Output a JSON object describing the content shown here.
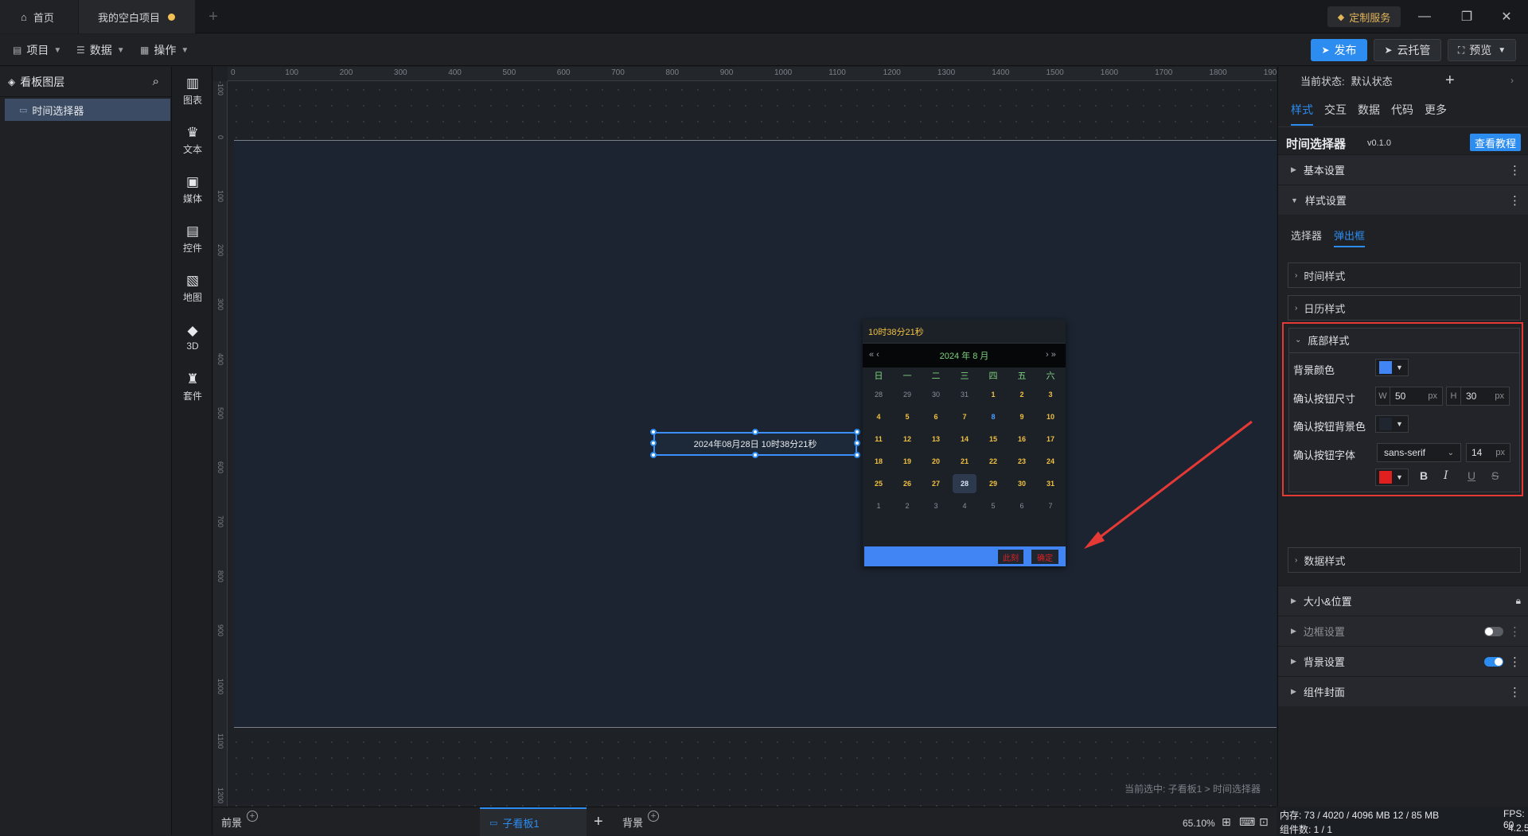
{
  "titlebar": {
    "tabs": [
      {
        "label": "首页"
      },
      {
        "label": "我的空白项目"
      }
    ],
    "custom_service": "定制服务"
  },
  "toolbar": {
    "menus": [
      {
        "label": "项目"
      },
      {
        "label": "数据"
      },
      {
        "label": "操作"
      }
    ],
    "publish": "发布",
    "cloud": "云托管",
    "preview": "预览"
  },
  "layers": {
    "title": "看板图层",
    "items": [
      {
        "label": "时间选择器"
      }
    ]
  },
  "strip": {
    "items": [
      {
        "label": "图表"
      },
      {
        "label": "文本"
      },
      {
        "label": "媒体"
      },
      {
        "label": "控件"
      },
      {
        "label": "地图"
      },
      {
        "label": "3D"
      },
      {
        "label": "套件"
      }
    ]
  },
  "ruler": {
    "top": [
      "0",
      "100",
      "200",
      "300",
      "400",
      "500",
      "600",
      "700",
      "800",
      "900",
      "1000",
      "1100",
      "1200",
      "1300",
      "1400",
      "1500",
      "1600",
      "1700",
      "1800",
      "1900"
    ],
    "left": [
      "-100",
      "0",
      "100",
      "200",
      "300",
      "400",
      "500",
      "600",
      "700",
      "800",
      "900",
      "1000",
      "1100",
      "1200"
    ]
  },
  "canvas": {
    "picker_value": "2024年08月28日 10时38分21秒",
    "selection_status": "当前选中: 子看板1 > 时间选择器"
  },
  "calendar": {
    "time": "10时38分21秒",
    "year_month": "2024 年  8 月",
    "nav_prev": "« ‹",
    "nav_next": "› »",
    "weekdays": [
      "日",
      "一",
      "二",
      "三",
      "四",
      "五",
      "六"
    ],
    "weeks": [
      [
        "28",
        "29",
        "30",
        "31",
        "1",
        "2",
        "3"
      ],
      [
        "4",
        "5",
        "6",
        "7",
        "8",
        "9",
        "10"
      ],
      [
        "11",
        "12",
        "13",
        "14",
        "15",
        "16",
        "17"
      ],
      [
        "18",
        "19",
        "20",
        "21",
        "22",
        "23",
        "24"
      ],
      [
        "25",
        "26",
        "27",
        "28",
        "29",
        "30",
        "31"
      ],
      [
        "1",
        "2",
        "3",
        "4",
        "5",
        "6",
        "7"
      ]
    ],
    "now_btn": "此刻",
    "ok_btn": "确定"
  },
  "bottombar": {
    "tabs": [
      {
        "label": "前景"
      },
      {
        "label": "子看板1"
      },
      {
        "label": "背景"
      }
    ],
    "zoom": "65.10%"
  },
  "rpanel": {
    "state_label": "当前状态:",
    "state_value": "默认状态",
    "tabs": [
      {
        "label": "样式"
      },
      {
        "label": "交互"
      },
      {
        "label": "数据"
      },
      {
        "label": "代码"
      },
      {
        "label": "更多"
      }
    ],
    "component_title": "时间选择器",
    "component_version": "v0.1.0",
    "tutorial_btn": "查看教程",
    "sections": {
      "basic": "基本设置",
      "style": "样式设置",
      "size_pos": "大小&位置",
      "border": "边框设置",
      "background": "背景设置",
      "cover": "组件封面"
    },
    "subtabs": [
      {
        "label": "选择器"
      },
      {
        "label": "弹出框"
      }
    ],
    "subsections": {
      "time_style": "时间样式",
      "calendar_style": "日历样式",
      "footer_style": "底部样式",
      "data_style": "数据样式"
    },
    "footer": {
      "bg_color_label": "背景颜色",
      "bg_color": "#4185f4",
      "btn_size_label": "确认按钮尺寸",
      "w_label": "W",
      "w_value": "50",
      "h_label": "H",
      "h_value": "30",
      "unit": "px",
      "btn_bg_label": "确认按钮背景色",
      "btn_bg_color": "#1f2630",
      "btn_font_label": "确认按钮字体",
      "font_family": "sans-serif",
      "font_size": "14",
      "font_color": "#e02020",
      "bold": "B",
      "italic": "I",
      "underline": "U",
      "strike": "S"
    }
  },
  "status": {
    "memory": "内存:  73 / 4020 / 4096 MB  12 / 85 MB",
    "fps": "FPS:  60",
    "component_count": "组件数: 1 / 1",
    "version": "4.2.5"
  }
}
